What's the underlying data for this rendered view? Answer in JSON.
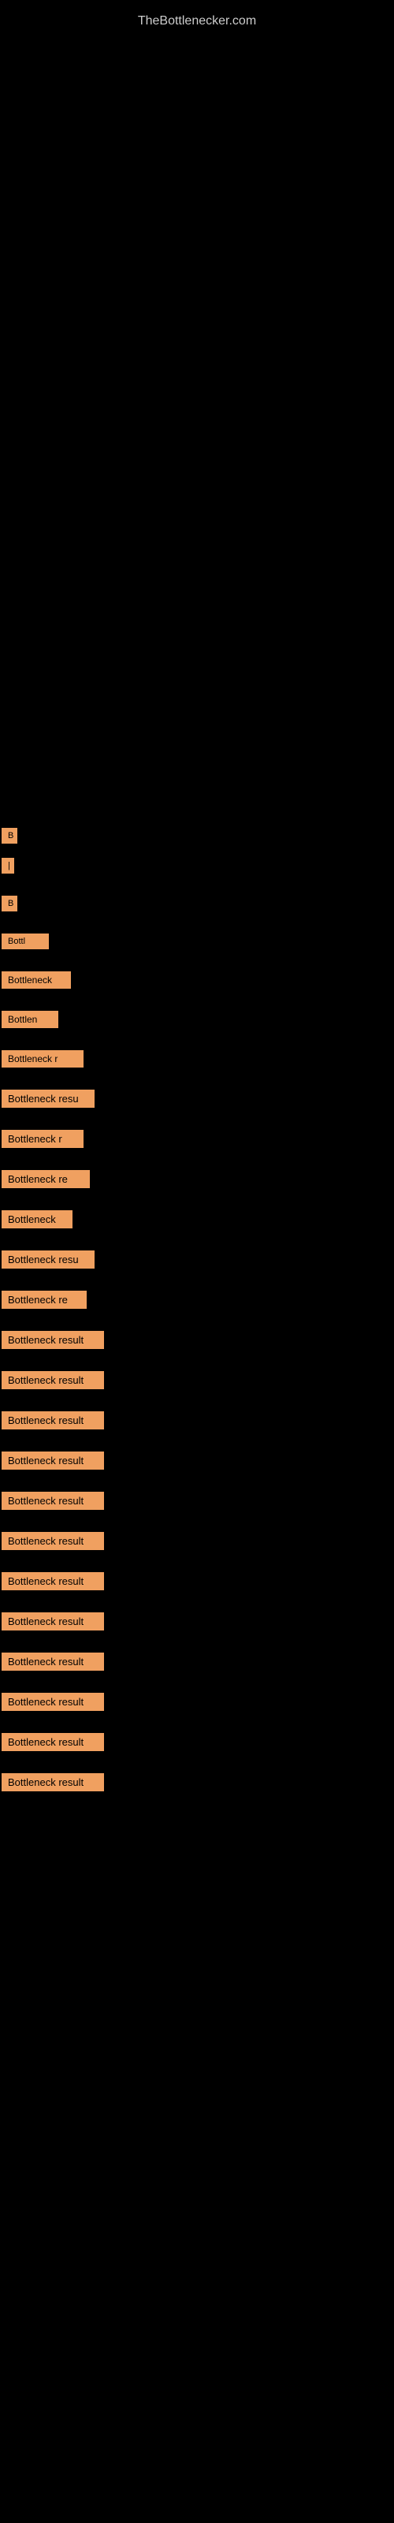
{
  "site": {
    "title": "TheBottlenecker.com"
  },
  "items": [
    {
      "label": "B",
      "class": "item-1"
    },
    {
      "label": "|",
      "class": "item-2"
    },
    {
      "label": "B",
      "class": "item-3"
    },
    {
      "label": "Bottl",
      "class": "item-4"
    },
    {
      "label": "Bottleneck",
      "class": "item-5"
    },
    {
      "label": "Bottlen",
      "class": "item-6"
    },
    {
      "label": "Bottleneck r",
      "class": "item-7"
    },
    {
      "label": "Bottleneck resu",
      "class": "item-8"
    },
    {
      "label": "Bottleneck r",
      "class": "item-9"
    },
    {
      "label": "Bottleneck re",
      "class": "item-10"
    },
    {
      "label": "Bottleneck",
      "class": "item-11"
    },
    {
      "label": "Bottleneck resu",
      "class": "item-12"
    },
    {
      "label": "Bottleneck re",
      "class": "item-13"
    },
    {
      "label": "Bottleneck result",
      "class": "item-14"
    },
    {
      "label": "Bottleneck result",
      "class": "item-15"
    },
    {
      "label": "Bottleneck result",
      "class": "item-16"
    },
    {
      "label": "Bottleneck result",
      "class": "item-17"
    },
    {
      "label": "Bottleneck result",
      "class": "item-18"
    },
    {
      "label": "Bottleneck result",
      "class": "item-19"
    },
    {
      "label": "Bottleneck result",
      "class": "item-20"
    },
    {
      "label": "Bottleneck result",
      "class": "item-21"
    },
    {
      "label": "Bottleneck result",
      "class": "item-22"
    },
    {
      "label": "Bottleneck result",
      "class": "item-23"
    },
    {
      "label": "Bottleneck result",
      "class": "item-24"
    },
    {
      "label": "Bottleneck result",
      "class": "item-25"
    }
  ]
}
